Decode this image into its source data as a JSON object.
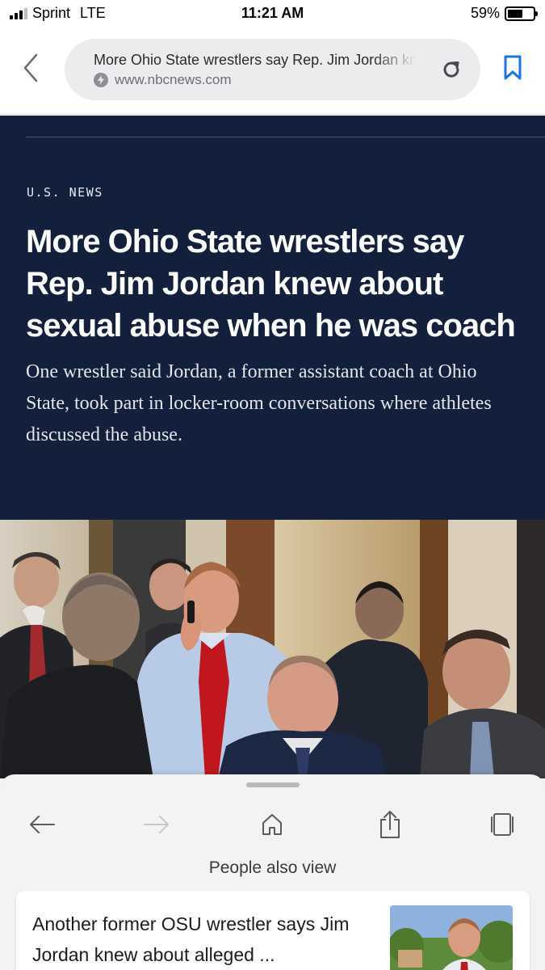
{
  "status_bar": {
    "carrier": "Sprint",
    "network": "LTE",
    "time": "11:21 AM",
    "battery_percent": "59%",
    "battery_level": 0.59
  },
  "browser": {
    "page_title": "More Ohio State wrestlers say Rep. Jim Jordan knew about sexual abuse when he was coach",
    "domain": "www.nbcnews.com",
    "icons": {
      "back": "chevron-left-icon",
      "amp": "bolt-icon",
      "reload": "reload-icon",
      "bookmark": "bookmark-icon"
    },
    "accent_color": "#1a73e8"
  },
  "article": {
    "section": "U.S. NEWS",
    "headline": "More Ohio State wrestlers say Rep. Jim Jordan knew about sexual abuse when he was coach",
    "dek": "One wrestler said Jordan, a former assistant coach at Ohio State, took part in locker-room conversations where athletes discussed the abuse.",
    "header_bg": "#13203b"
  },
  "bottom_sheet": {
    "nav": {
      "back": "arrow-left-icon",
      "forward": "arrow-right-icon",
      "home": "home-icon",
      "share": "share-icon",
      "tabs": "tabs-icon"
    },
    "people_also_view_label": "People also view",
    "cards": [
      {
        "title": "Another former OSU wrestler says Jim Jordan knew about alleged ..."
      }
    ]
  }
}
